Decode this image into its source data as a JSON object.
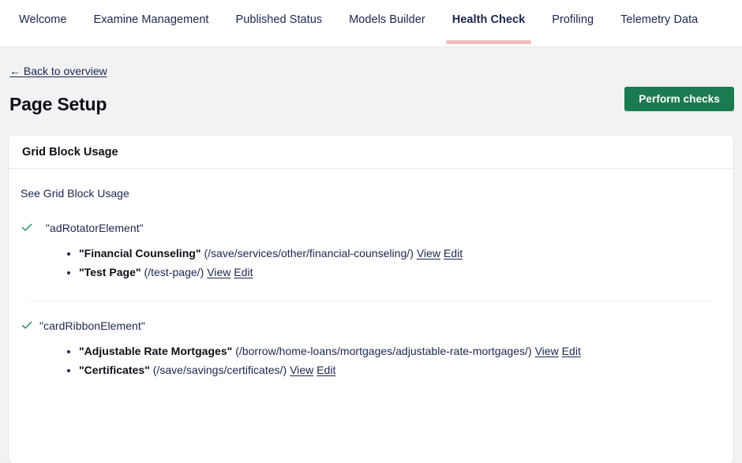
{
  "tabs": [
    {
      "label": "Welcome",
      "active": false
    },
    {
      "label": "Examine Management",
      "active": false
    },
    {
      "label": "Published Status",
      "active": false
    },
    {
      "label": "Models Builder",
      "active": false
    },
    {
      "label": "Health Check",
      "active": true
    },
    {
      "label": "Profiling",
      "active": false
    },
    {
      "label": "Telemetry Data",
      "active": false
    }
  ],
  "header": {
    "back_link": "← Back to overview",
    "title": "Page Setup",
    "perform_button": "Perform checks"
  },
  "card": {
    "title": "Grid Block Usage",
    "intro": "See Grid Block Usage"
  },
  "checks": [
    {
      "status_icon": "check-icon",
      "label": "\"adRotatorElement\"",
      "pages": [
        {
          "name": "\"Financial Counseling\"",
          "path": "(/save/services/other/financial-counseling/)",
          "view": "View",
          "edit": "Edit"
        },
        {
          "name": "\"Test Page\"",
          "path": "(/test-page/)",
          "view": "View",
          "edit": "Edit"
        }
      ]
    },
    {
      "status_icon": "check-icon",
      "label": "\"cardRibbonElement\"",
      "pages": [
        {
          "name": "\"Adjustable Rate Mortgages\"",
          "path": "(/borrow/home-loans/mortgages/adjustable-rate-mortgages/)",
          "view": "View",
          "edit": "Edit"
        },
        {
          "name": "\"Certificates\"",
          "path": "(/save/savings/certificates/)",
          "view": "View",
          "edit": "Edit"
        }
      ]
    }
  ],
  "colors": {
    "page_background": "#f2f2f4",
    "card_background": "#ffffff",
    "accent_green": "#1b7a4f",
    "active_tab_underline": "#f0c0bc",
    "text": "#1b264f"
  }
}
